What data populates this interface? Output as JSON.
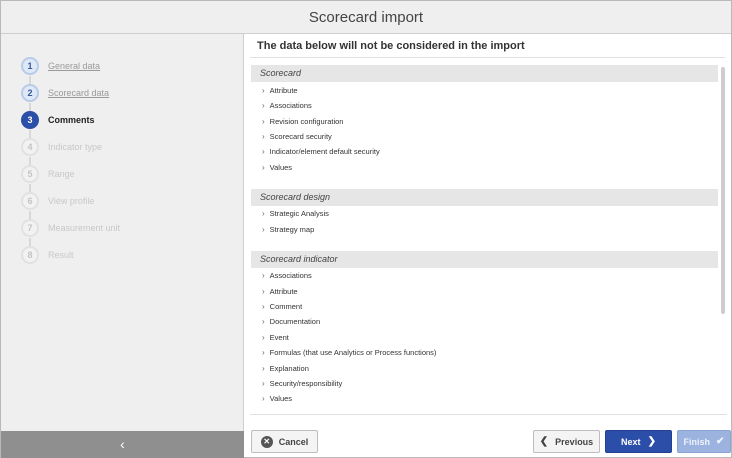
{
  "window": {
    "title": "Scorecard import"
  },
  "sidebar": {
    "steps": [
      {
        "number": "1",
        "label": "General data",
        "state": "done"
      },
      {
        "number": "2",
        "label": "Scorecard data",
        "state": "done"
      },
      {
        "number": "3",
        "label": "Comments",
        "state": "current"
      },
      {
        "number": "4",
        "label": "Indicator type",
        "state": "pending"
      },
      {
        "number": "5",
        "label": "Range",
        "state": "pending"
      },
      {
        "number": "6",
        "label": "View profile",
        "state": "pending"
      },
      {
        "number": "7",
        "label": "Measurement unit",
        "state": "pending"
      },
      {
        "number": "8",
        "label": "Result",
        "state": "pending"
      }
    ],
    "collapse_icon": "chevron-left-icon",
    "collapse_glyph": "‹"
  },
  "main": {
    "heading": "The data below will not be considered in the import",
    "sections": [
      {
        "title": "Scorecard",
        "items": [
          "Attribute",
          "Associations",
          "Revision configuration",
          "Scorecard security",
          "Indicator/element default security",
          "Values"
        ]
      },
      {
        "title": "Scorecard design",
        "items": [
          "Strategic Analysis",
          "Strategy map"
        ]
      },
      {
        "title": "Scorecard indicator",
        "items": [
          "Associations",
          "Attribute",
          "Comment",
          "Documentation",
          "Event",
          "Formulas (that use Analytics or Process functions)",
          "Explanation",
          "Security/responsibility",
          "Values"
        ]
      }
    ],
    "item_chevron": "›"
  },
  "footer": {
    "cancel_label": "Cancel",
    "previous_label": "Previous",
    "next_label": "Next",
    "finish_label": "Finish",
    "cancel_glyph": "✕",
    "previous_glyph": "❮",
    "next_glyph": "❯",
    "finish_glyph": "✔"
  },
  "colors": {
    "accent": "#2b4ea8",
    "finish_disabled": "#9cb3e0",
    "sidebar_bg": "#efefef",
    "section_bg": "#e6e6e6"
  }
}
